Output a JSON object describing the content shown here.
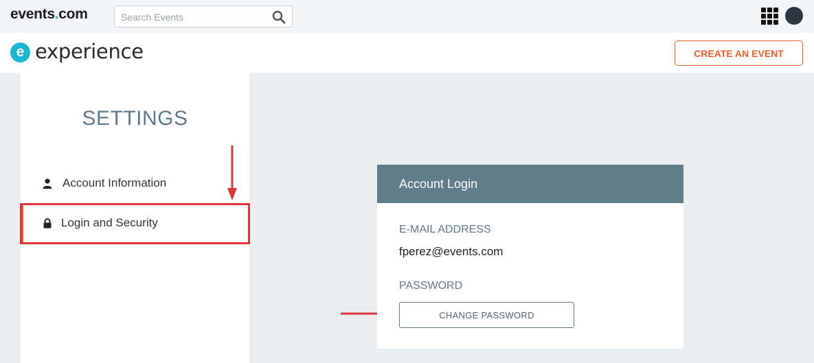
{
  "topbar": {
    "logo_prefix": "events",
    "logo_dot": ".",
    "logo_suffix": "com",
    "search_placeholder": "Search Events",
    "search_icon": "search-icon",
    "apps_icon": "apps-grid-icon",
    "avatar_icon": "user-avatar"
  },
  "subheader": {
    "brand_letter": "e",
    "brand_name": "experience",
    "create_button": "CREATE AN EVENT"
  },
  "sidebar": {
    "title": "SETTINGS",
    "items": [
      {
        "label": "Account Information",
        "icon": "person-icon",
        "active": false
      },
      {
        "label": "Login and Security",
        "icon": "lock-icon",
        "active": true
      }
    ]
  },
  "card": {
    "title": "Account Login",
    "email_label": "E-MAIL ADDRESS",
    "email_value": "fperez@events.com",
    "password_label": "PASSWORD",
    "change_password_button": "CHANGE PASSWORD"
  },
  "colors": {
    "accent": "#f05a28",
    "brand": "#19b6d3",
    "card_header": "#607d8b",
    "annotation": "#e0343b"
  }
}
